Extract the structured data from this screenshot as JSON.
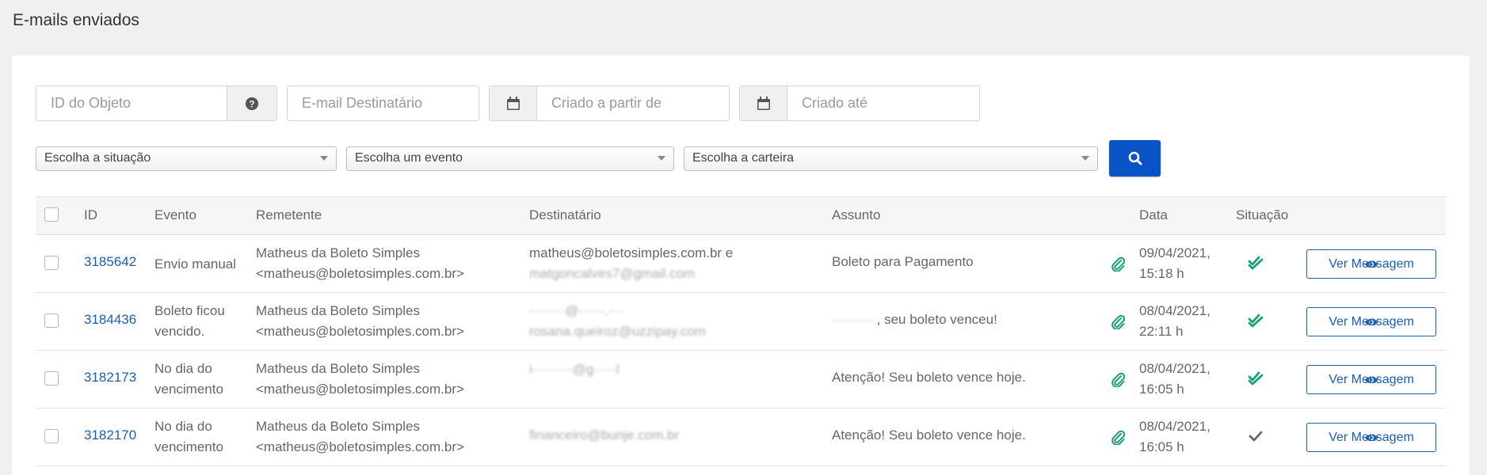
{
  "page": {
    "title": "E-mails enviados"
  },
  "filters": {
    "id_placeholder": "ID do Objeto",
    "email_placeholder": "E-mail Destinatário",
    "created_from_placeholder": "Criado a partir de",
    "created_until_placeholder": "Criado até",
    "status_select": "Escolha a situação",
    "event_select": "Escolha um evento",
    "wallet_select": "Escolha a carteira"
  },
  "table": {
    "headers": {
      "id": "ID",
      "event": "Evento",
      "sender": "Remetente",
      "recipient": "Destinatário",
      "subject": "Assunto",
      "date": "Data",
      "status": "Situação"
    },
    "view_label": "Ver Mensagem",
    "rows": [
      {
        "id": "3185642",
        "event_l1": "Envio manual",
        "event_l2": "",
        "sender_l1": "Matheus da Boleto Simples",
        "sender_l2": "<matheus@boletosimples.com.br>",
        "recipient_l1": "matheus@boletosimples.com.br e",
        "recipient_l2": "matgoncalves7@gmail.com",
        "subject": "Boleto para Pagamento",
        "date_l1": "09/04/2021,",
        "date_l2": "15:18 h",
        "status_icon": "double-check-icon"
      },
      {
        "id": "3184436",
        "event_l1": "Boleto ficou",
        "event_l2": "vencido.",
        "sender_l1": "Matheus da Boleto Simples",
        "sender_l2": "<matheus@boletosimples.com.br>",
        "recipient_l1": "········@······.···",
        "recipient_l2": "rosana.queiroz@uzzipay.com",
        "subject_prefix": "··········",
        "subject": ", seu boleto venceu!",
        "date_l1": "08/04/2021,",
        "date_l2": "22:11 h",
        "status_icon": "double-check-icon"
      },
      {
        "id": "3182173",
        "event_l1": "No dia do",
        "event_l2": "vencimento",
        "sender_l1": "Matheus da Boleto Simples",
        "sender_l2": "<matheus@boletosimples.com.br>",
        "recipient_l1": "i·········@g·····l",
        "recipient_l2": "",
        "subject": "Atenção! Seu boleto vence hoje.",
        "date_l1": "08/04/2021,",
        "date_l2": "16:05 h",
        "status_icon": "double-check-icon"
      },
      {
        "id": "3182170",
        "event_l1": "No dia do",
        "event_l2": "vencimento",
        "sender_l1": "Matheus da Boleto Simples",
        "sender_l2": "<matheus@boletosimples.com.br>",
        "recipient_l1": "financeiro@bunje.com.br",
        "recipient_l2": "",
        "subject": "Atenção! Seu boleto vence hoje.",
        "date_l1": "08/04/2021,",
        "date_l2": "16:05 h",
        "status_icon": "check-icon"
      }
    ]
  },
  "colors": {
    "primary": "#0a53c7",
    "link": "#1a5fb4",
    "success": "#1a9e7a",
    "muted_check": "#666666"
  }
}
